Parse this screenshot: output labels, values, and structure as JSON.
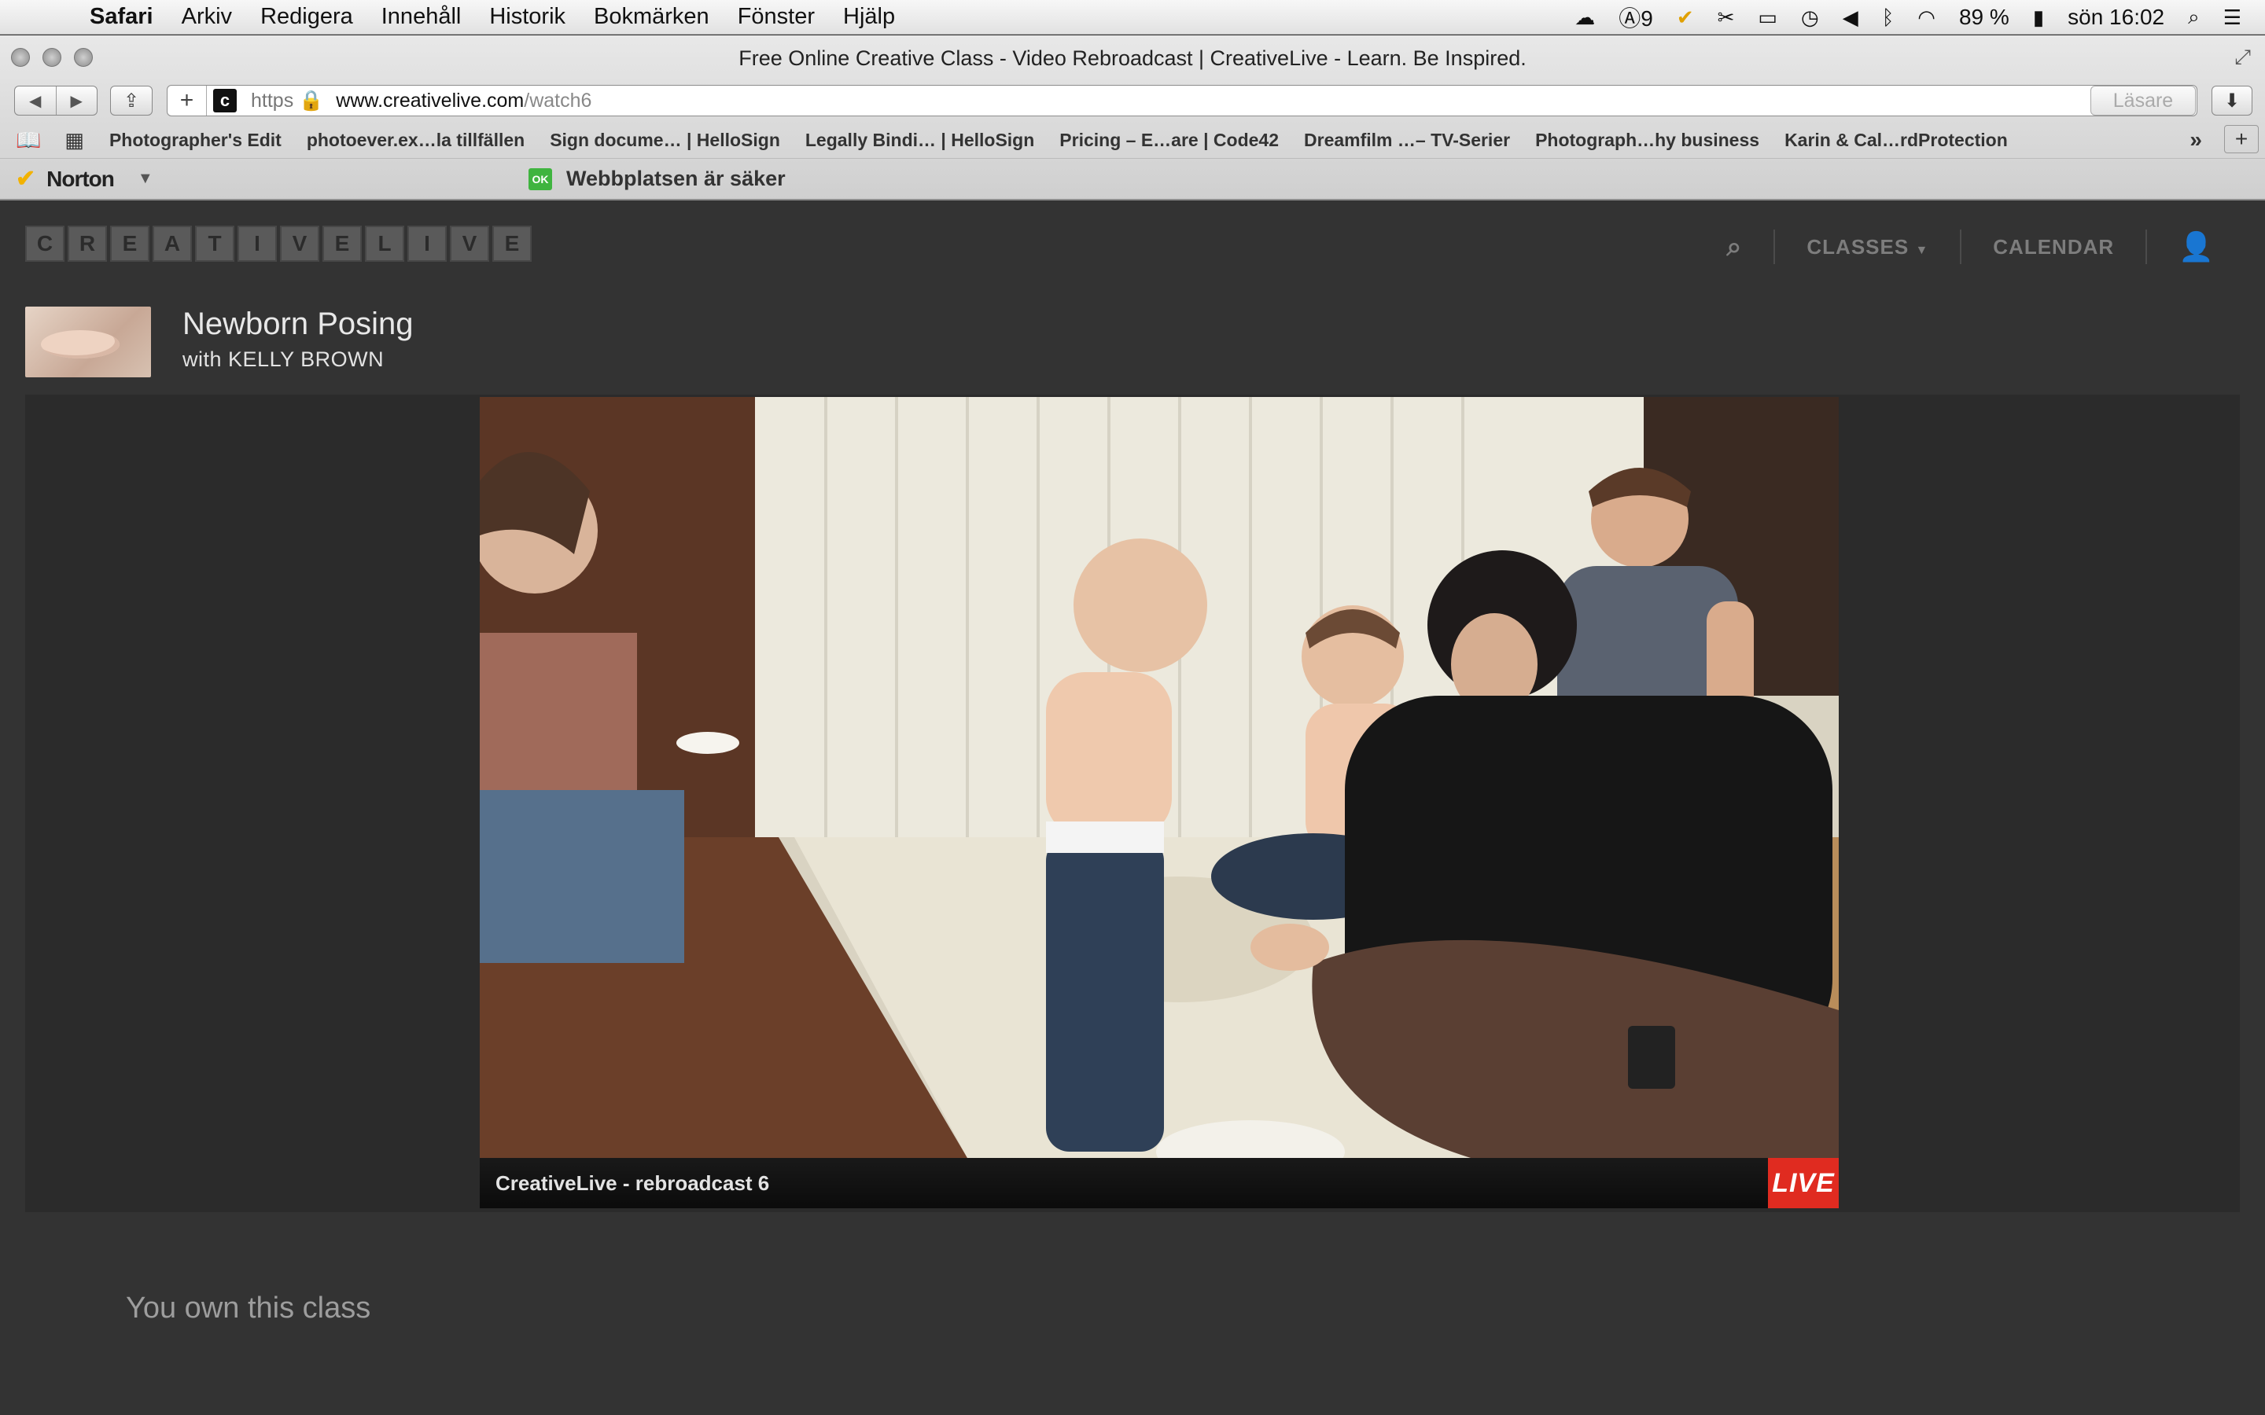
{
  "menubar": {
    "app": "Safari",
    "items": [
      "Arkiv",
      "Redigera",
      "Innehåll",
      "Historik",
      "Bokmärken",
      "Fönster",
      "Hjälp"
    ],
    "adobe_count": "9",
    "battery": "89 %",
    "clock": "sön 16:02"
  },
  "browser": {
    "window_title": "Free Online Creative Class - Video Rebroadcast | CreativeLive - Learn. Be Inspired.",
    "favicon_letter": "c",
    "scheme": "https",
    "url_host": "www.creativelive.com",
    "url_path": "/watch6",
    "reader_label": "Läsare",
    "bookmarks": [
      "Photographer's Edit",
      "photoever.ex…la tillfällen",
      "Sign docume… | HelloSign",
      "Legally Bindi… | HelloSign",
      "Pricing – E…are | Code42",
      "Dreamfilm …– TV-Serier",
      "Photograph…hy business",
      "Karin & Cal…rdProtection"
    ]
  },
  "norton": {
    "label": "Norton",
    "badge": "OK",
    "status": "Webbplatsen är säker"
  },
  "site": {
    "logo_letters": [
      "C",
      "R",
      "E",
      "A",
      "T",
      "I",
      "V",
      "E",
      "L",
      "I",
      "V",
      "E"
    ],
    "nav": {
      "classes": "CLASSES",
      "calendar": "CALENDAR"
    },
    "class_title": "Newborn Posing",
    "instructor_prefix": "with ",
    "instructor": "KELLY BROWN",
    "video_title": "CreativeLive - rebroadcast 6",
    "live_label": "LIVE",
    "ownership": "You own this class"
  },
  "icons": {
    "apple": "apple-icon",
    "search": "search-icon",
    "user": "user-icon",
    "wifi": "wifi-icon",
    "battery": "battery-icon"
  }
}
